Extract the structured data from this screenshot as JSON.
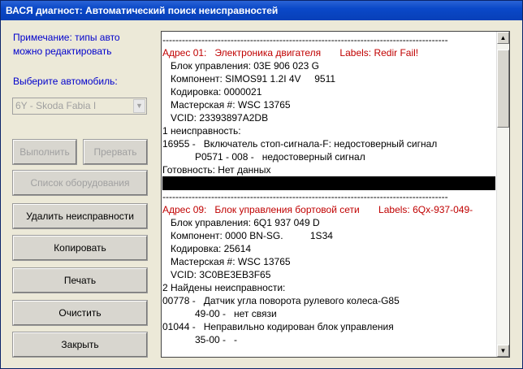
{
  "window": {
    "title": "ВАСЯ диагност: Автоматический поиск неисправностей"
  },
  "left_panel": {
    "note": "Примечание: типы авто можно редактировать",
    "choose_label": "Выберите автомобиль:",
    "car_select": {
      "value": "6Y - Skoda Fabia I"
    },
    "buttons": {
      "run": "Выполнить",
      "stop": "Прервать",
      "equipment": "Список оборудования",
      "clear_faults": "Удалить неисправности",
      "copy": "Копировать",
      "print": "Печать",
      "clean": "Очистить",
      "close": "Закрыть"
    }
  },
  "log": {
    "lines": [
      {
        "text": "----------------------------------------------------------------------------------------",
        "style": "normal"
      },
      {
        "text": "Адрес 01:   Электроника двигателя       Labels: Redir Fail!",
        "style": "red"
      },
      {
        "text": "   Блок управления: 03E 906 023 G",
        "style": "normal"
      },
      {
        "text": "   Компонент: SIMOS91 1.2I 4V     9511",
        "style": "normal"
      },
      {
        "text": "   Кодировка: 0000021",
        "style": "normal"
      },
      {
        "text": "   Мастерская #: WSC 13765",
        "style": "normal"
      },
      {
        "text": "   VCID: 23393897A2DB",
        "style": "normal"
      },
      {
        "text": "1 неисправность:",
        "style": "normal"
      },
      {
        "text": "16955 -   Включатель стоп-сигнала-F: недостоверный сигнал",
        "style": "normal"
      },
      {
        "text": "            P0571 - 008 -   недостоверный сигнал",
        "style": "normal"
      },
      {
        "text": "Готовность: Нет данных",
        "style": "normal"
      },
      {
        "text": "",
        "style": "blackbar"
      },
      {
        "text": "----------------------------------------------------------------------------------------",
        "style": "normal"
      },
      {
        "text": "Адрес 09:   Блок управления бортовой сети       Labels: 6Qx-937-049-",
        "style": "red"
      },
      {
        "text": "   Блок управления: 6Q1 937 049 D",
        "style": "normal"
      },
      {
        "text": "   Компонент: 0000 BN-SG.          1S34",
        "style": "normal"
      },
      {
        "text": "   Кодировка: 25614",
        "style": "normal"
      },
      {
        "text": "   Мастерская #: WSC 13765",
        "style": "normal"
      },
      {
        "text": "   VCID: 3C0BE3EB3F65",
        "style": "normal"
      },
      {
        "text": "2 Найдены неисправности:",
        "style": "normal"
      },
      {
        "text": "00778 -   Датчик угла поворота рулевого колеса-G85",
        "style": "normal"
      },
      {
        "text": "            49-00 -   нет связи",
        "style": "normal"
      },
      {
        "text": "01044 -   Неправильно кодирован блок управления",
        "style": "normal"
      },
      {
        "text": "            35-00 -   -",
        "style": "normal"
      }
    ]
  },
  "icons": {
    "select_arrow": "chevron-down-icon",
    "scroll_up": "arrow-up-icon",
    "scroll_down": "arrow-down-icon"
  }
}
